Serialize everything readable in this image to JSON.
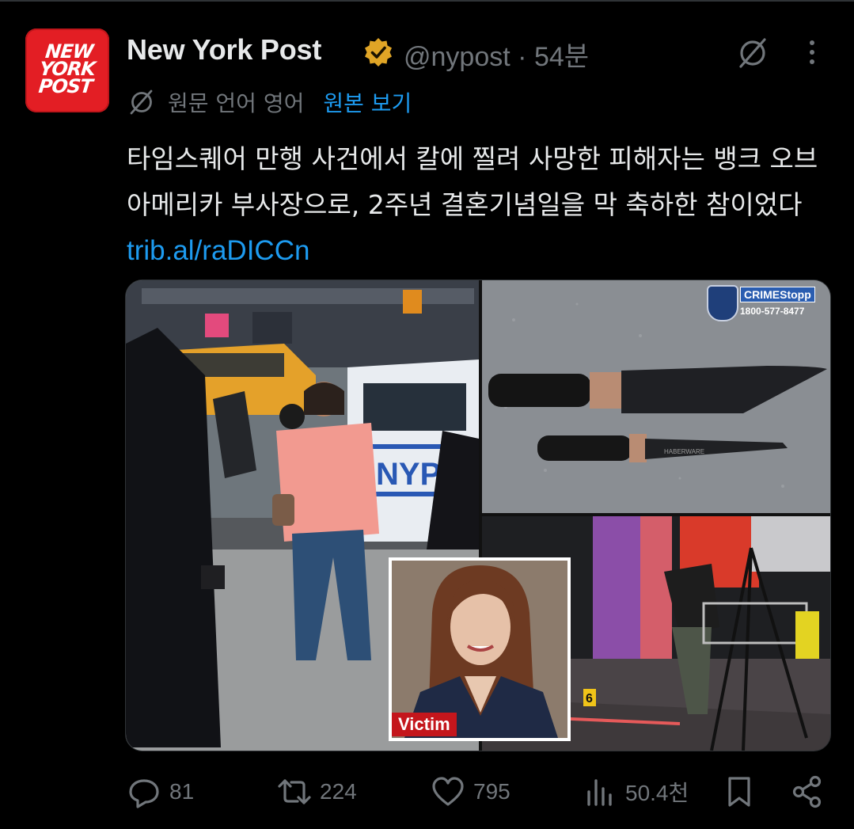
{
  "author": {
    "logo_lines": [
      "NEW",
      "YORK",
      "POST"
    ],
    "name": "New York Post",
    "handle": "@nypost",
    "separator": "·",
    "time": "54분"
  },
  "translation": {
    "note": "원문 언어 영어",
    "show_original": "원본 보기"
  },
  "tweet": {
    "text": "타임스퀘어 만행 사건에서 칼에 찔려 사망한 피해자는 뱅크 오브 아메리카 부사장으로, 2주년 결혼기념일을 막 축하한 참이었다 ",
    "link": "trib.al/raDICCn"
  },
  "media": {
    "knife_badge_title": "CRIMEStopp",
    "knife_badge_phone": "1800-577-8477",
    "police_car_text": "NYP",
    "evidence_marker": "6",
    "victim_label": "Victim"
  },
  "stats": {
    "replies": "81",
    "reposts": "224",
    "likes": "795",
    "views": "50.4천"
  },
  "colors": {
    "background": "#000000",
    "text": "#e7e9ea",
    "muted": "#71767b",
    "link": "#1d9bf0",
    "verified": "#e0a526",
    "brand": "#e31e24"
  }
}
